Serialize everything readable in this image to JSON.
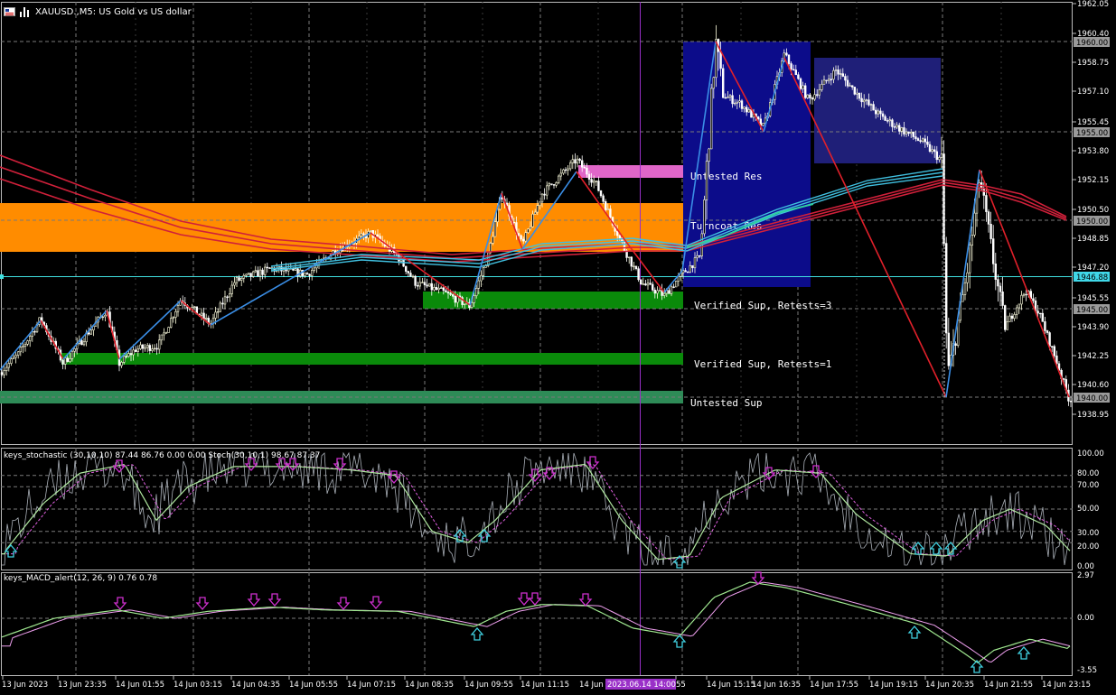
{
  "chart": {
    "symbol_title": "XAUUSD.,M5: US Gold vs US dollar",
    "stoch_title": "keys_stochastic (30,10,10) 87.44 86.76 0.00 0.00 Stoch(30,10,1) 98.67 87.37",
    "macd_title": "keys_MACD_alert(12, 26, 9) 0.76 0.78",
    "vline_label": "2023.06.14 14:00"
  },
  "main_axis": {
    "ticks": [
      "1962.05",
      "1960.40",
      "1958.75",
      "1957.10",
      "1955.45",
      "1953.80",
      "1952.15",
      "1950.50",
      "1948.85",
      "1947.20",
      "1945.55",
      "1943.90",
      "1942.25",
      "1940.60",
      "1938.95"
    ],
    "badges": [
      {
        "text": "1960.00",
        "style": "gray"
      },
      {
        "text": "1955.00",
        "style": "gray"
      },
      {
        "text": "1950.00",
        "style": "gray"
      },
      {
        "text": "1946.88",
        "style": "cyan"
      },
      {
        "text": "1945.00",
        "style": "gray"
      },
      {
        "text": "1940.00",
        "style": "gray"
      }
    ]
  },
  "stoch_axis": {
    "ticks": [
      "100.00",
      "80.00",
      "70.00",
      "50.00",
      "30.00",
      "20.00",
      "0.00"
    ]
  },
  "macd_axis": {
    "ticks": [
      "2.97",
      "0.00",
      "-3.55"
    ]
  },
  "time_axis": {
    "labels": [
      "13 Jun 2023",
      "13 Jun 23:35",
      "14 Jun 01:55",
      "14 Jun 03:15",
      "14 Jun 04:35",
      "14 Jun 05:55",
      "14 Jun 07:15",
      "14 Jun 08:35",
      "14 Jun 09:55",
      "14 Jun 11:15",
      "14 Jun 14",
      "55",
      "14 Jun 15:15",
      "14 Jun 16:35",
      "14 Jun 17:55",
      "14 Jun 19:15",
      "14 Jun 20:35",
      "14 Jun 21:55",
      "14 Jun 23:15"
    ]
  },
  "zones": [
    {
      "label": "Untested Res",
      "color": "#e066c8"
    },
    {
      "label": "Turncoat Res",
      "color": "#ff8c00"
    },
    {
      "label": "Verified Sup, Retests=3",
      "color": "#0a8a0a"
    },
    {
      "label": "Verified Sup, Retests=1",
      "color": "#0a8a0a"
    },
    {
      "label": "Untested Sup",
      "color": "#2e8b57"
    }
  ],
  "colors": {
    "bull_candle": "#ffffe0",
    "bear_candle": "#ffffff",
    "zigzag_up": "#3a8ee6",
    "zigzag_down": "#e0202a",
    "ma_red": "#d0203a",
    "ma_cyan": "#40c0e0",
    "box_blue": "#10108a",
    "box_navy": "#1e1e78",
    "stoch_main": "#b0e8a0",
    "stoch_signal": "#e060e0",
    "macd_main": "#a0e890",
    "macd_signal": "#f0a0f0",
    "arrow_down": "#d030d0",
    "arrow_up": "#40d0e0",
    "vline": "#9a30c8",
    "grid": "#7a7a7a"
  }
}
